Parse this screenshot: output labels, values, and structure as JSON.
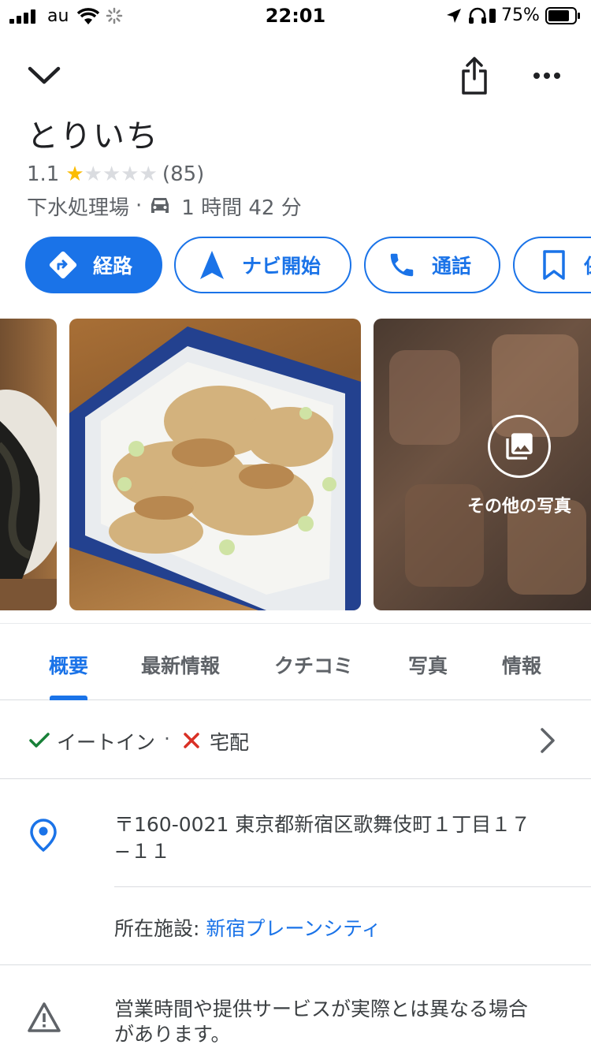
{
  "status_bar": {
    "carrier": "au",
    "time": "22:01",
    "battery": "75%"
  },
  "place": {
    "name": "とりいち",
    "rating": "1.1",
    "stars_filled": 1,
    "stars_total": 5,
    "review_count": "(85)",
    "category": "下水処理場",
    "separator": "·",
    "travel_time": "1 時間 42 分"
  },
  "actions": [
    {
      "label": "経路",
      "icon": "directions-icon"
    },
    {
      "label": "ナビ開始",
      "icon": "navigation-arrow-icon"
    },
    {
      "label": "通話",
      "icon": "phone-icon"
    },
    {
      "label": "保",
      "icon": "bookmark-icon"
    }
  ],
  "photos": {
    "more_label": "その他の写真"
  },
  "tabs": [
    {
      "label": "概要",
      "active": true
    },
    {
      "label": "最新情報",
      "active": false
    },
    {
      "label": "クチコミ",
      "active": false
    },
    {
      "label": "写真",
      "active": false
    },
    {
      "label": "情報",
      "active": false
    }
  ],
  "services": {
    "dine_in": "イートイン",
    "separator": "·",
    "delivery": "宅配"
  },
  "address": {
    "line1": "〒160-0021 東京都新宿区歌舞伎町１丁目１７",
    "line2": "−１１"
  },
  "facility": {
    "prefix": "所在施設: ",
    "name": "新宿プレーンシティ"
  },
  "notice": {
    "line1": "営業時間や提供サービスが実際とは異なる場合",
    "line2": "があります。"
  },
  "colors": {
    "accent": "#1a73e8",
    "star": "#fbbc04",
    "check": "#188038",
    "cross": "#d93025"
  }
}
